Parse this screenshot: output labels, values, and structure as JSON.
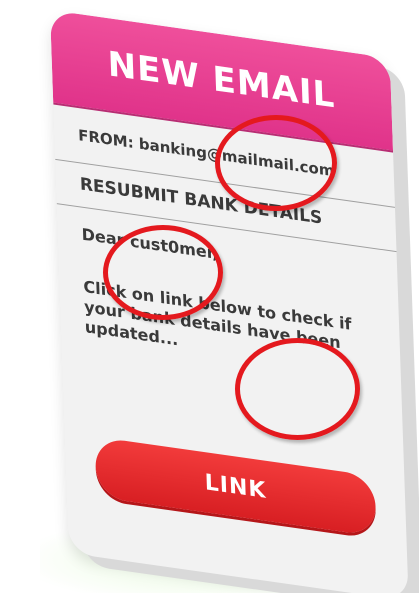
{
  "email": {
    "header_title": "NEW EMAIL",
    "from_line": "FROM: banking@mailmail.com",
    "subject_line": "RESUBMIT BANK DETAILS",
    "greeting": "Dear cust0mer,",
    "body": "Click on link below to check if your bank details have been updated...",
    "link_label": "LINK"
  },
  "colors": {
    "header": "#e0338a",
    "card_background": "#f2f2f2",
    "button": "#d81f23",
    "highlight_circle": "#e4191e"
  }
}
